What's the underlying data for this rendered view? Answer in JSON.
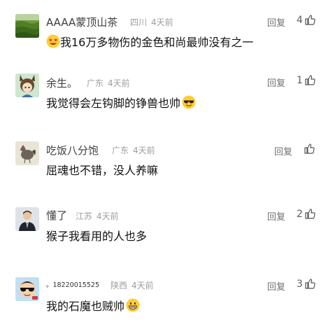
{
  "comments": [
    {
      "username": "AAAA蒙顶山茶",
      "location": "四川",
      "time": "4天前",
      "reply_label": "回复",
      "like_count": "4",
      "body": "我16万多物伤的金色和尚最帅没有之一",
      "emoji_before": "heart-eyes-emoji",
      "avatar": "tea-plantation-avatar"
    },
    {
      "username": "余生。",
      "location": "广东",
      "time": "4天前",
      "reply_label": "回复",
      "like_count": "1",
      "body": "我觉得会左钩脚的铮兽也帅",
      "emoji_after": "sunglasses-emoji",
      "avatar": "anime-character-avatar"
    },
    {
      "username": "吃饭八分饱",
      "location": "广东",
      "time": "4天前",
      "reply_label": "回复",
      "like_count": "",
      "body": "屈魂也不错，没人养嘛",
      "avatar": "rooster-avatar"
    },
    {
      "username": "懂了",
      "location": "江苏",
      "time": "4天前",
      "reply_label": "回复",
      "like_count": "2",
      "body": "猴子我看用的人也多",
      "avatar": "suited-man-avatar"
    },
    {
      "username": "。18220015525",
      "location": "陕西",
      "time": "4天前",
      "reply_label": "回复",
      "like_count": "3",
      "body": "我的石魔也贼帅",
      "emoji_after": "grinning-emoji",
      "avatar": "cartoon-sunglasses-avatar"
    }
  ],
  "colors": {
    "username": "#404040",
    "meta": "#9e9e9e",
    "body": "#111111",
    "background": "#ffffff"
  }
}
